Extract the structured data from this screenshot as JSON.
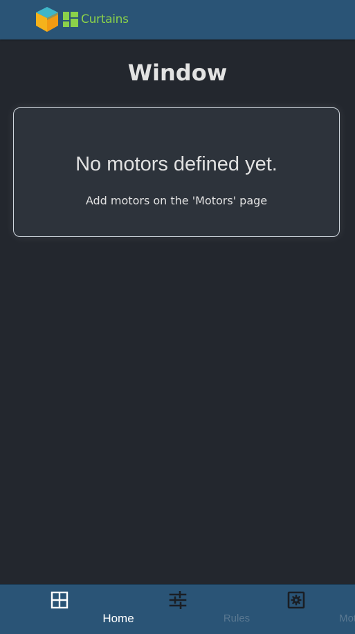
{
  "header": {
    "app_name": "Curtains"
  },
  "page": {
    "title": "Window"
  },
  "empty_state": {
    "heading": "No motors defined yet.",
    "message": "Add motors on the 'Motors' page"
  },
  "bottom_nav": {
    "items": [
      {
        "label": "Home",
        "icon": "grid-icon",
        "active": true
      },
      {
        "label": "Rules",
        "icon": "sliders-icon",
        "active": false
      },
      {
        "label": "Motors",
        "icon": "gear-box-icon",
        "active": false
      }
    ]
  },
  "colors": {
    "header_bg": "#2a5476",
    "page_bg": "#23272e",
    "brand_green": "#8bd14a",
    "nav_active": "#ffffff",
    "nav_inactive": "#5a7891"
  }
}
